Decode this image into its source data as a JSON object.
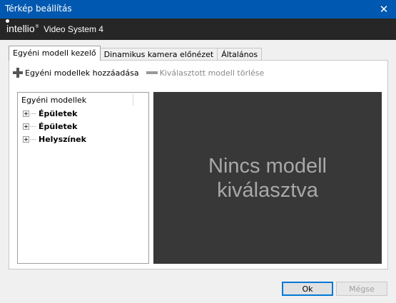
{
  "window": {
    "title": "Térkép beállítás",
    "close_glyph": "✕"
  },
  "brand": {
    "logo": "intellio",
    "registered": "®",
    "product": "Video System 4"
  },
  "tabs": [
    {
      "label": "Egyéni modell kezelő",
      "active": true
    },
    {
      "label": "Dinamikus kamera előnézet",
      "active": false
    },
    {
      "label": "Általános",
      "active": false
    }
  ],
  "toolbar": {
    "add_label": "Egyéni modellek hozzáadása",
    "add_icon": "plus-icon",
    "remove_label": "Kiválasztott modell törlése",
    "remove_icon": "minus-icon"
  },
  "tree": {
    "header": "Egyéni modellek",
    "nodes": [
      {
        "label": "Épületek"
      },
      {
        "label": "Épületek"
      },
      {
        "label": "Helyszínek"
      }
    ]
  },
  "viewer": {
    "message_line1": "Nincs modell",
    "message_line2": "kiválasztva"
  },
  "buttons": {
    "ok": "Ok",
    "cancel": "Mégse"
  },
  "colors": {
    "titlebar": "#0058b0",
    "brandbar": "#262626",
    "viewer": "#383838",
    "accent": "#0078d7"
  }
}
